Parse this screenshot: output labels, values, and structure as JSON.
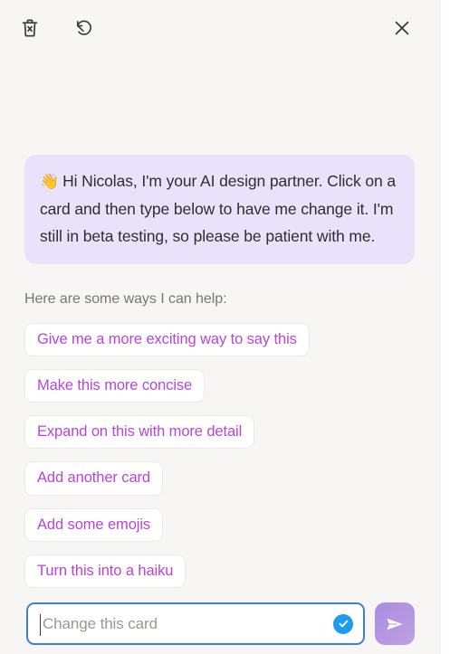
{
  "panel": {
    "background_color": "#f7f6f4",
    "accent_purple": "#b845d8",
    "bubble_color": "#e8e3fb",
    "focus_blue": "#3b82d6",
    "check_blue": "#1d9bf0",
    "send_purple": "#a98ce2"
  },
  "header": {
    "clear_label": "Clear conversation",
    "reset_label": "Undo",
    "close_label": "Close"
  },
  "conversation": {
    "assistant_message": {
      "emoji": "👋",
      "text": "Hi Nicolas, I'm your AI design partner. Click on a card and then type below to have me change it. I'm still in beta testing, so please be patient with me."
    },
    "suggestions_label": "Here are some ways I can help:",
    "suggestions": [
      {
        "label": "Give me a more exciting way to say this"
      },
      {
        "label": "Make this more concise"
      },
      {
        "label": "Expand on this with more detail"
      },
      {
        "label": "Add another card"
      },
      {
        "label": "Add some emojis"
      },
      {
        "label": "Turn this into a haiku"
      }
    ]
  },
  "composer": {
    "input_value": "",
    "input_placeholder": "Change this card",
    "confirm_label": "Apply",
    "send_label": "Send"
  }
}
